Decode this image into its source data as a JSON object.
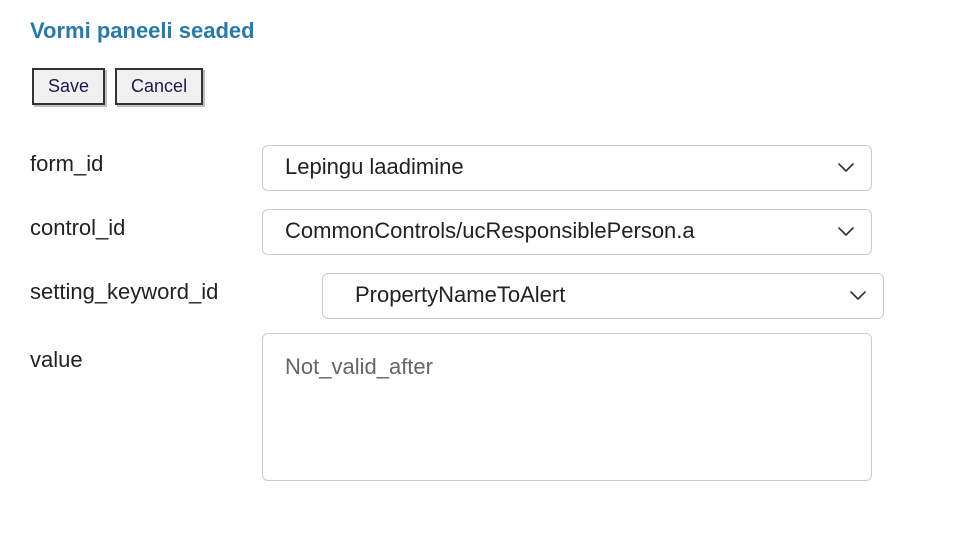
{
  "title": "Vormi paneeli seaded",
  "buttons": {
    "save": "Save",
    "cancel": "Cancel"
  },
  "fields": {
    "form_id": {
      "label": "form_id",
      "value": "Lepingu laadimine"
    },
    "control_id": {
      "label": "control_id",
      "value": "CommonControls/ucResponsiblePerson.a"
    },
    "setting_keyword_id": {
      "label": "setting_keyword_id",
      "value": "PropertyNameToAlert"
    },
    "value": {
      "label": "value",
      "text": "Not_valid_after"
    }
  }
}
